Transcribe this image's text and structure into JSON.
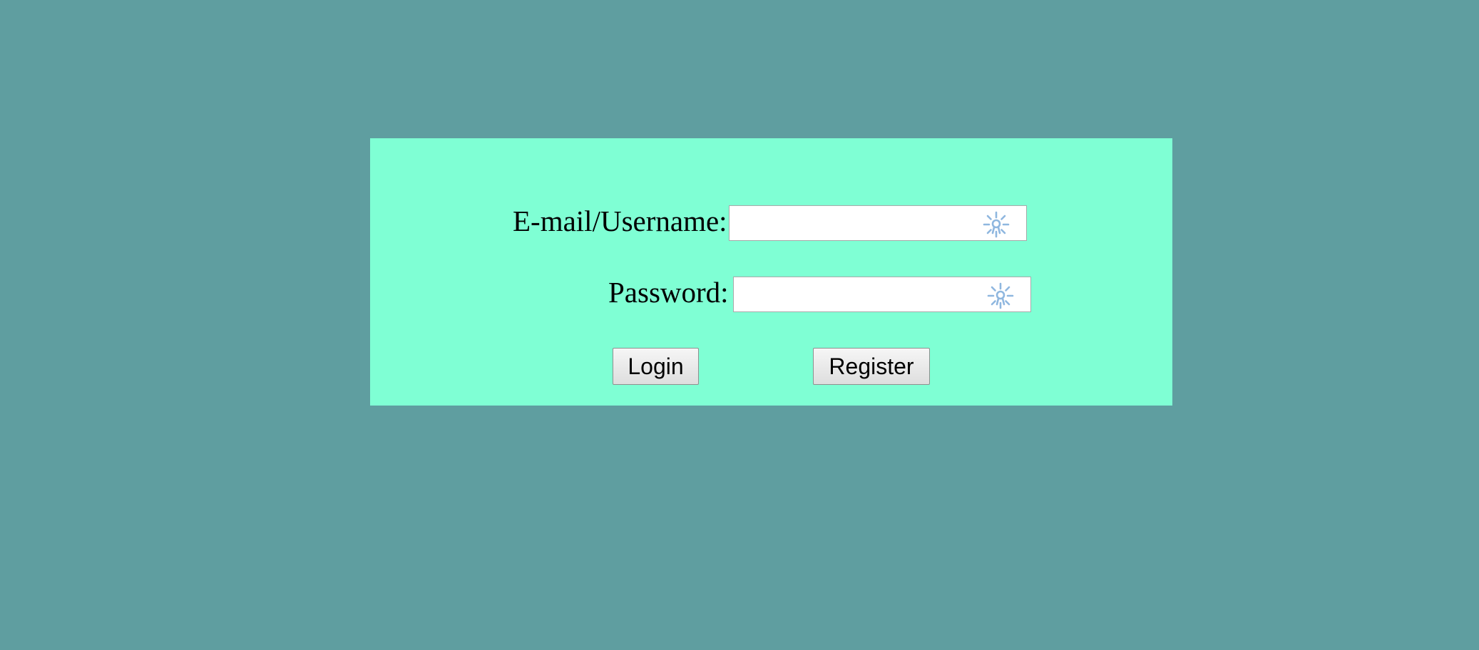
{
  "colors": {
    "page_background": "#5f9ea0",
    "panel_background": "#7fffd4",
    "input_background": "#ffffff",
    "icon_color": "#8fb7df"
  },
  "form": {
    "email_label": "E-mail/Username:",
    "email_value": "",
    "password_label": "Password:",
    "password_value": "",
    "field_icon": "password-manager-key-icon"
  },
  "buttons": {
    "login_label": "Login",
    "register_label": "Register"
  }
}
